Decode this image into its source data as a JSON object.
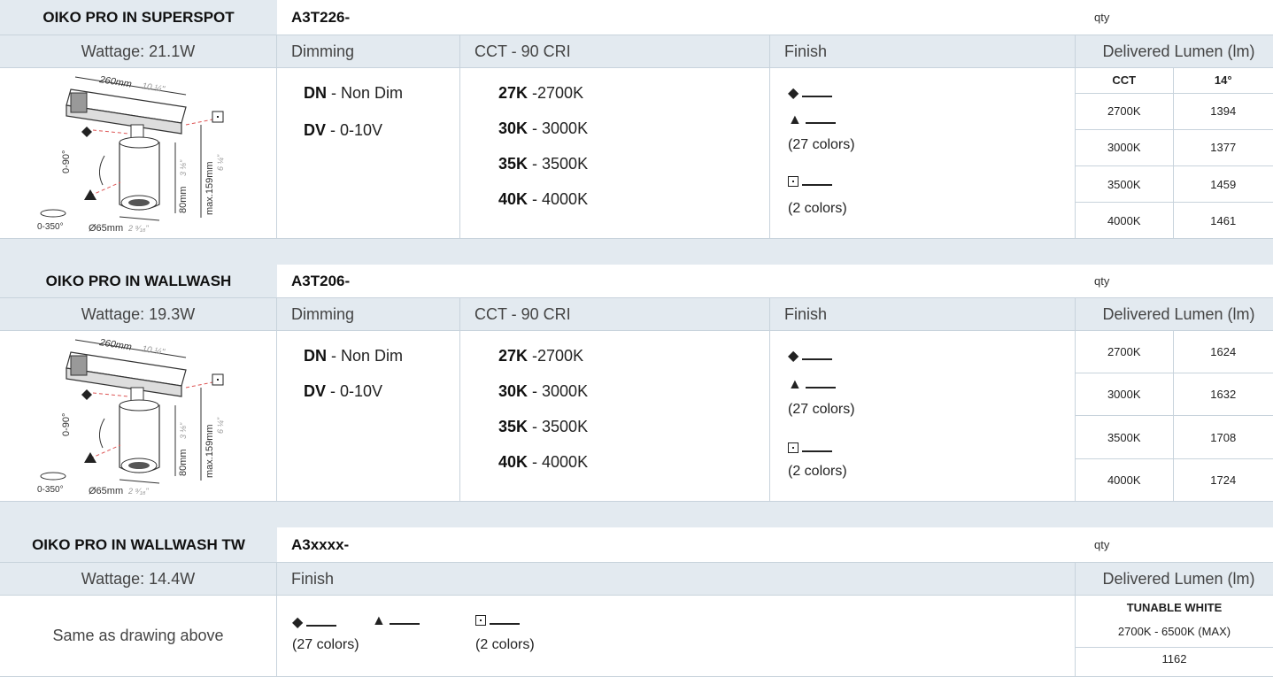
{
  "sections": [
    {
      "name": "OIKO PRO IN SUPERSPOT",
      "code": "A3T226-",
      "qty": "qty",
      "wattage": "Wattage: 21.1W",
      "dimming_header": "Dimming",
      "cct_header": "CCT - 90 CRI",
      "finish_header": "Finish",
      "lumen_header": "Delivered Lumen (lm)",
      "dimming": [
        {
          "code": "DN",
          "text": " - Non Dim"
        },
        {
          "code": "DV",
          "text": " - 0-10V"
        }
      ],
      "cct": [
        {
          "code": "27K",
          "text": " -2700K"
        },
        {
          "code": "30K",
          "text": " - 3000K"
        },
        {
          "code": "35K",
          "text": " - 3500K"
        },
        {
          "code": "40K",
          "text": " - 4000K"
        }
      ],
      "finish": {
        "colors27": "(27 colors)",
        "colors2": "(2 colors)"
      },
      "lumen_table_header": {
        "cct": "CCT",
        "beam": "14°"
      },
      "lumen_rows": [
        {
          "cct": "2700K",
          "lm": "1394"
        },
        {
          "cct": "3000K",
          "lm": "1377"
        },
        {
          "cct": "3500K",
          "lm": "1459"
        },
        {
          "cct": "4000K",
          "lm": "1461"
        }
      ]
    },
    {
      "name": "OIKO PRO IN WALLWASH",
      "code": "A3T206-",
      "qty": "qty",
      "wattage": "Wattage: 19.3W",
      "dimming_header": "Dimming",
      "cct_header": "CCT - 90 CRI",
      "finish_header": "Finish",
      "lumen_header": "Delivered Lumen (lm)",
      "dimming": [
        {
          "code": "DN",
          "text": " - Non Dim"
        },
        {
          "code": "DV",
          "text": " - 0-10V"
        }
      ],
      "cct": [
        {
          "code": "27K",
          "text": " -2700K"
        },
        {
          "code": "30K",
          "text": " - 3000K"
        },
        {
          "code": "35K",
          "text": " - 3500K"
        },
        {
          "code": "40K",
          "text": " - 4000K"
        }
      ],
      "finish": {
        "colors27": "(27 colors)",
        "colors2": "(2 colors)"
      },
      "lumen_rows": [
        {
          "cct": "2700K",
          "lm": "1624"
        },
        {
          "cct": "3000K",
          "lm": "1632"
        },
        {
          "cct": "3500K",
          "lm": "1708"
        },
        {
          "cct": "4000K",
          "lm": "1724"
        }
      ]
    },
    {
      "name": "OIKO PRO IN WALLWASH TW",
      "code": "A3xxxx-",
      "qty": "qty",
      "wattage": "Wattage: 14.4W",
      "finish_header": "Finish",
      "lumen_header": "Delivered Lumen (lm)",
      "drawing_note": "Same as drawing above",
      "finish": {
        "colors27": "(27 colors)",
        "colors2": "(2 colors)"
      },
      "tw_title": "TUNABLE WHITE",
      "tw_range": "2700K - 6500K (MAX)",
      "tw_lumen": "1162"
    }
  ],
  "drawing_labels": {
    "width": "260mm",
    "width_in": "10 ¼\"",
    "tilt": "0-90°",
    "rotate": "0-350°",
    "diam": "Ø65mm",
    "diam_in": "2 ⁹⁄₁₆\"",
    "body_h": "80mm",
    "body_h_in": "3 ⅛\"",
    "max_h": "max.159mm",
    "max_h_in": "6 ¼\""
  }
}
